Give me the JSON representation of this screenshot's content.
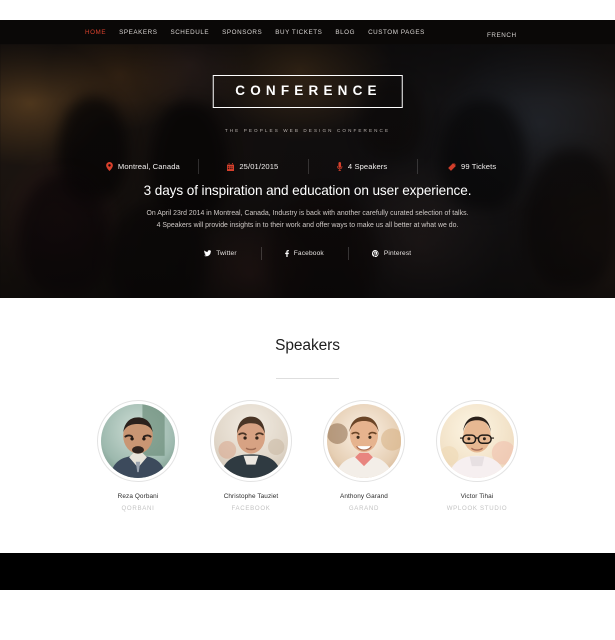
{
  "nav": {
    "items": [
      {
        "label": "HOME",
        "active": true
      },
      {
        "label": "SPEAKERS",
        "active": false
      },
      {
        "label": "SCHEDULE",
        "active": false
      },
      {
        "label": "SPONSORS",
        "active": false
      },
      {
        "label": "BUY TICKETS",
        "active": false
      },
      {
        "label": "BLOG",
        "active": false
      },
      {
        "label": "CUSTOM PAGES",
        "active": false
      }
    ],
    "language": "FRENCH",
    "active_color": "#d8402c"
  },
  "hero": {
    "logo": "CONFERENCE",
    "tagline": "THE PEOPLES WEB DESIGN CONFERENCE",
    "headline": "3 days of inspiration and education on user experience.",
    "description_line1": "On April 23rd 2014 in Montreal, Canada, Industry is back with another carefully curated selection of talks.",
    "description_line2": "4 Speakers will provide insights in to their work and offer ways to make us all better at what we do.",
    "info": [
      {
        "icon": "map-pin-icon",
        "label": "Montreal, Canada"
      },
      {
        "icon": "calendar-icon",
        "label": "25/01/2015"
      },
      {
        "icon": "microphone-icon",
        "label": "4 Speakers"
      },
      {
        "icon": "tickets-icon",
        "label": "99 Tickets"
      }
    ],
    "social": [
      {
        "icon": "twitter-icon",
        "label": "Twitter"
      },
      {
        "icon": "facebook-icon",
        "label": "Facebook"
      },
      {
        "icon": "pinterest-icon",
        "label": "Pinterest"
      }
    ],
    "accent_color": "#d8402c"
  },
  "speakers_section": {
    "title": "Speakers",
    "speakers": [
      {
        "name": "Reza Qorbani",
        "role": "QORBANI"
      },
      {
        "name": "Christophe Tauziet",
        "role": "FACEBOOK"
      },
      {
        "name": "Anthony Garand",
        "role": "GARAND"
      },
      {
        "name": "Victor Tihai",
        "role": "WPLOOK STUDIO"
      }
    ]
  }
}
